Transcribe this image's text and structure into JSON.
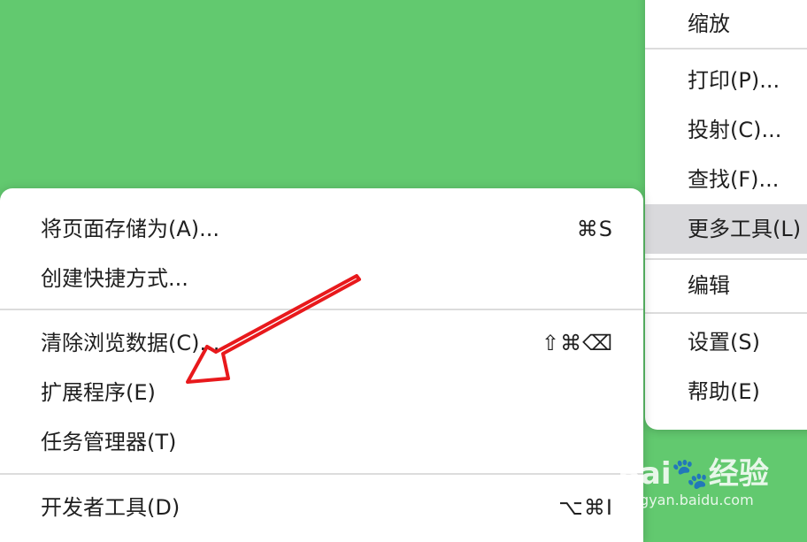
{
  "main_menu": {
    "items": [
      {
        "label": "缩放"
      },
      {
        "label": "打印(P)..."
      },
      {
        "label": "投射(C)..."
      },
      {
        "label": "查找(F)..."
      },
      {
        "label": "更多工具(L)"
      },
      {
        "label": "编辑"
      },
      {
        "label": "设置(S)"
      },
      {
        "label": "帮助(E)"
      }
    ]
  },
  "sub_menu": {
    "items": [
      {
        "label": "将页面存储为(A)...",
        "shortcut": "⌘S"
      },
      {
        "label": "创建快捷方式...",
        "shortcut": ""
      },
      {
        "label": "清除浏览数据(C)...",
        "shortcut": "⇧⌘⌫"
      },
      {
        "label": "扩展程序(E)",
        "shortcut": ""
      },
      {
        "label": "任务管理器(T)",
        "shortcut": ""
      },
      {
        "label": "开发者工具(D)",
        "shortcut": "⌥⌘I"
      }
    ]
  },
  "watermark": {
    "logo": "Bai🐾经验",
    "url": "jingyan.baidu.com"
  },
  "colors": {
    "background": "#62c96f",
    "highlight": "#d9d9dc",
    "arrow": "#e8191c"
  }
}
